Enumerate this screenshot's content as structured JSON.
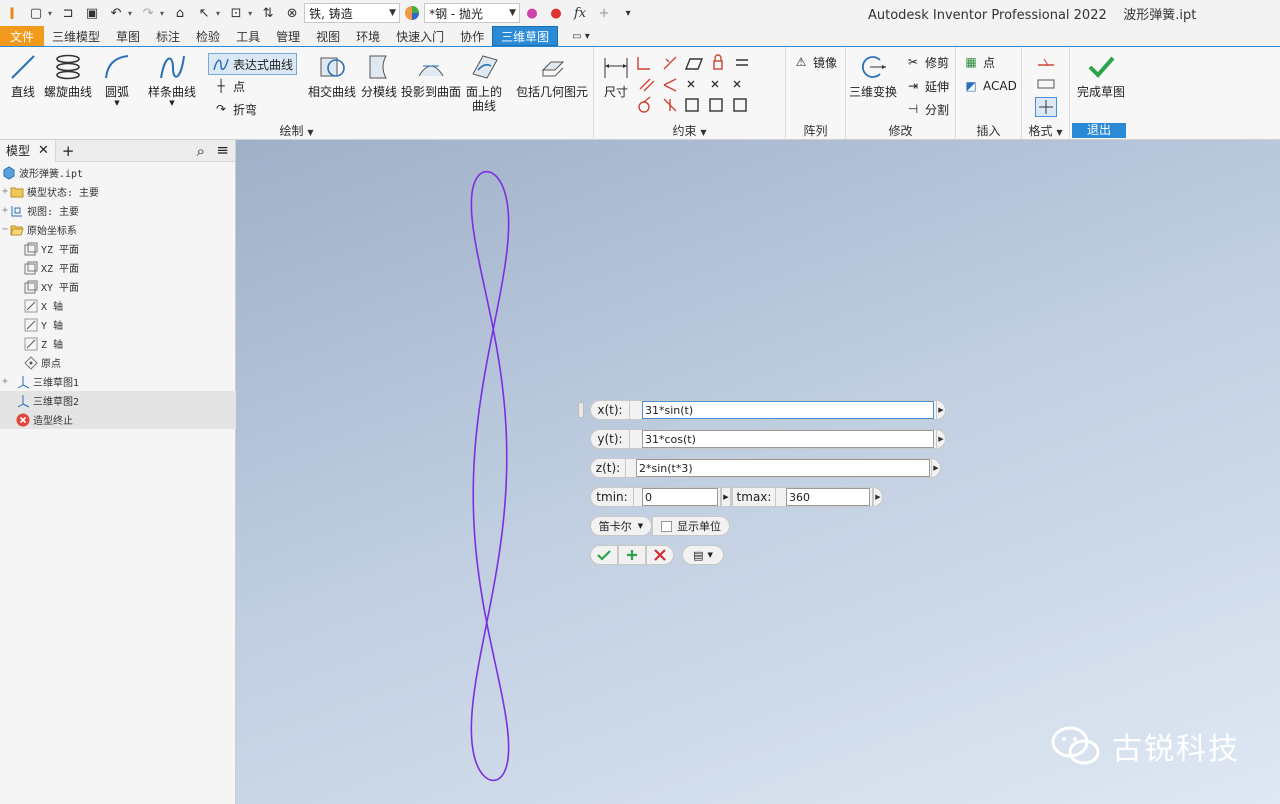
{
  "quick_access": {
    "material": "铁, 铸造",
    "appearance": "*钢 - 抛光"
  },
  "title": {
    "app": "Autodesk Inventor Professional 2022",
    "file": "波形弹簧.ipt"
  },
  "menu_tabs": [
    "文件",
    "三维模型",
    "草图",
    "标注",
    "检验",
    "工具",
    "管理",
    "视图",
    "环境",
    "快速入门",
    "协作",
    "三维草图"
  ],
  "ribbon": {
    "draw": {
      "title": "绘制",
      "line": "直线",
      "helix": "螺旋曲线",
      "arc": "圆弧",
      "spline": "样条曲线",
      "equation_curve": "表达式曲线",
      "point": "点",
      "bend": "折弯",
      "intersection": "相交曲线",
      "silhouette": "分模线",
      "project_to_surface": "投影到曲面",
      "curve_on_face_1": "面上的",
      "curve_on_face_2": "曲线",
      "include_geometry": "包括几何图元"
    },
    "constrain": {
      "title": "约束",
      "dimension": "尺寸"
    },
    "pattern": {
      "title": "阵列",
      "mirror": "镜像"
    },
    "modify": {
      "title": "修改",
      "transform": "三维变换",
      "trim": "修剪",
      "extend": "延伸",
      "split": "分割"
    },
    "insert": {
      "title": "插入",
      "point": "点",
      "acad": "ACAD"
    },
    "format": {
      "title": "格式"
    },
    "exit": {
      "finish": "完成草图",
      "title": "退出"
    }
  },
  "browser": {
    "tab": "模型",
    "items": [
      {
        "label": "波形弹簧.ipt"
      },
      {
        "label": "模型状态: 主要"
      },
      {
        "label": "视图: 主要"
      },
      {
        "label": "原始坐标系"
      },
      {
        "label": "YZ 平面"
      },
      {
        "label": "XZ 平面"
      },
      {
        "label": "XY 平面"
      },
      {
        "label": "X 轴"
      },
      {
        "label": "Y 轴"
      },
      {
        "label": "Z 轴"
      },
      {
        "label": "原点"
      },
      {
        "label": "三维草图1"
      },
      {
        "label": "三维草图2"
      },
      {
        "label": "造型终止"
      }
    ]
  },
  "equation_dialog": {
    "x_label": "x(t):",
    "x_value": "31*sin(t)",
    "y_label": "y(t):",
    "y_value": "31*cos(t)",
    "z_label": "z(t):",
    "z_value": "2*sin(t*3)",
    "tmin_label": "tmin:",
    "tmin_value": "0",
    "tmax_label": "tmax:",
    "tmax_value": "360",
    "coord_system": "笛卡尔",
    "show_units": "显示单位"
  },
  "watermark": "古锐科技",
  "colors": {
    "accent": "#2b8ad6",
    "file_tab": "#f39a1c",
    "curve": "#7b2fe0",
    "ok": "#2aa34a",
    "cancel": "#d32f2f"
  }
}
